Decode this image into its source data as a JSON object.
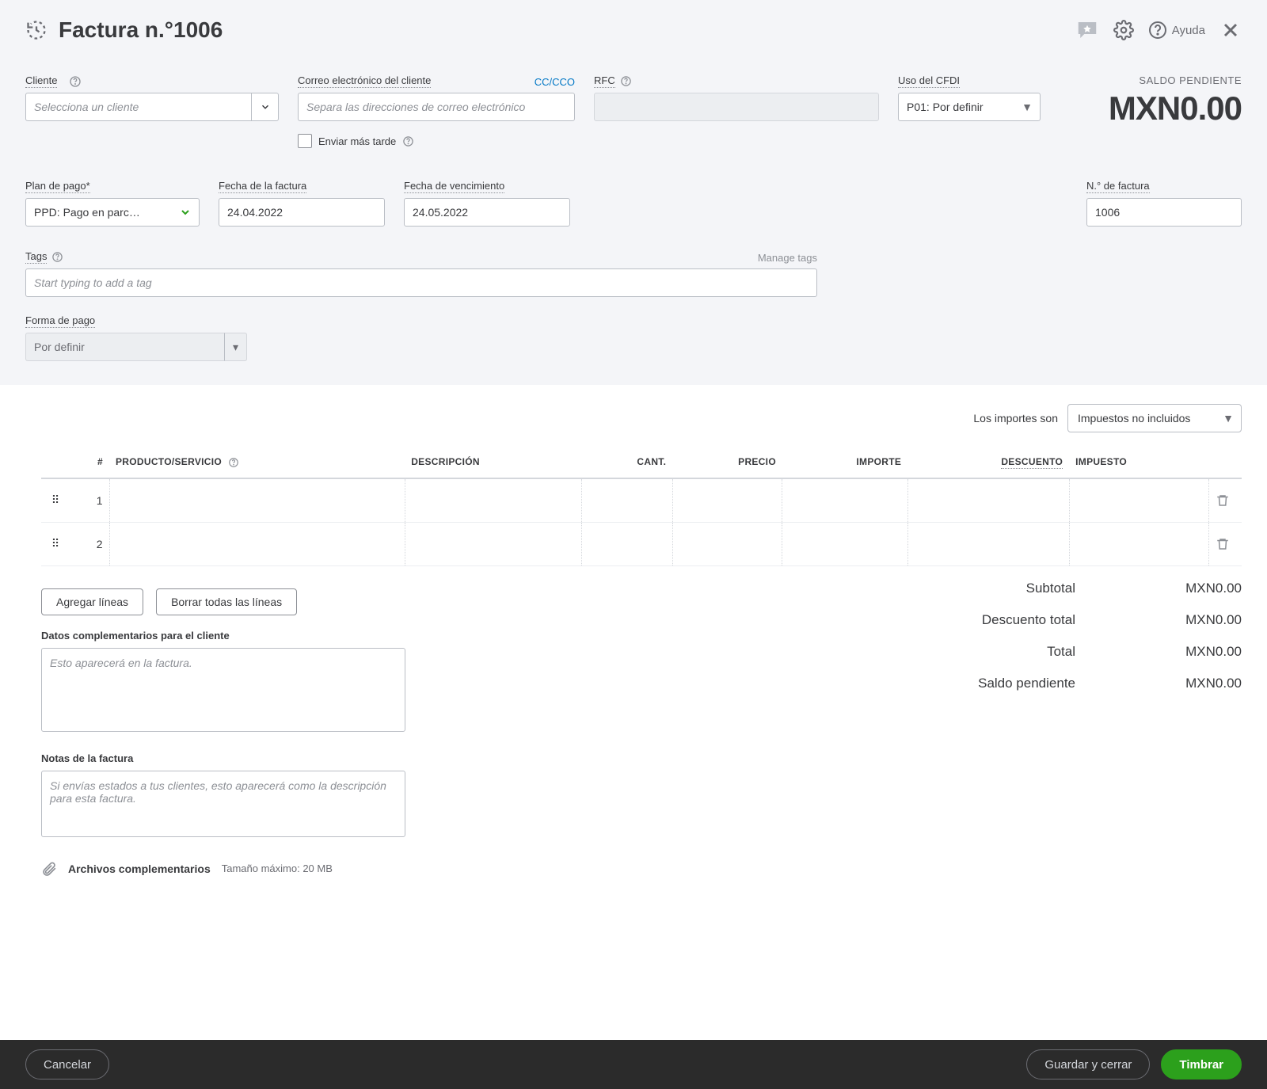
{
  "header": {
    "title": "Factura n.°1006",
    "help": "Ayuda"
  },
  "balance": {
    "label": "SALDO PENDIENTE",
    "amount": "MXN0.00"
  },
  "fields": {
    "client_label": "Cliente",
    "client_placeholder": "Selecciona un cliente",
    "email_label": "Correo electrónico del cliente",
    "email_placeholder": "Separa las direcciones de correo electrónico",
    "cc_link": "CC/CCO",
    "send_later": "Enviar más tarde",
    "rfc_label": "RFC",
    "cfdi_label": "Uso del CFDI",
    "cfdi_value": "P01: Por definir",
    "plan_label": "Plan de pago*",
    "plan_value": "PPD: Pago en parc…",
    "invoice_date_label": "Fecha de la factura",
    "invoice_date_value": "24.04.2022",
    "due_date_label": "Fecha de vencimiento",
    "due_date_value": "24.05.2022",
    "invoice_no_label": "N.° de factura",
    "invoice_no_value": "1006",
    "tags_label": "Tags",
    "tags_placeholder": "Start typing to add a tag",
    "manage_tags": "Manage tags",
    "payment_form_label": "Forma de pago",
    "payment_form_value": "Por definir"
  },
  "amounts": {
    "label": "Los importes son",
    "value": "Impuestos no incluidos"
  },
  "columns": {
    "hash": "#",
    "product": "PRODUCTO/SERVICIO",
    "description": "DESCRIPCIÓN",
    "qty": "CANT.",
    "price": "PRECIO",
    "amount": "IMPORTE",
    "discount": "DESCUENTO",
    "tax": "IMPUESTO"
  },
  "rows": [
    {
      "num": "1"
    },
    {
      "num": "2"
    }
  ],
  "line_actions": {
    "add": "Agregar líneas",
    "clear": "Borrar todas las líneas"
  },
  "totals": {
    "subtotal_label": "Subtotal",
    "subtotal_value": "MXN0.00",
    "discount_label": "Descuento total",
    "discount_value": "MXN0.00",
    "total_label": "Total",
    "total_value": "MXN0.00",
    "balance_label": "Saldo pendiente",
    "balance_value": "MXN0.00"
  },
  "memos": {
    "cust_label": "Datos complementarios para el cliente",
    "cust_placeholder": "Esto aparecerá en la factura.",
    "notes_label": "Notas de la factura",
    "notes_placeholder": "Si envías estados a tus clientes, esto aparecerá como la descripción para esta factura."
  },
  "attachments": {
    "label": "Archivos complementarios",
    "size": "Tamaño máximo: 20 MB"
  },
  "footer": {
    "cancel": "Cancelar",
    "save": "Guardar y cerrar",
    "timbrar": "Timbrar"
  }
}
